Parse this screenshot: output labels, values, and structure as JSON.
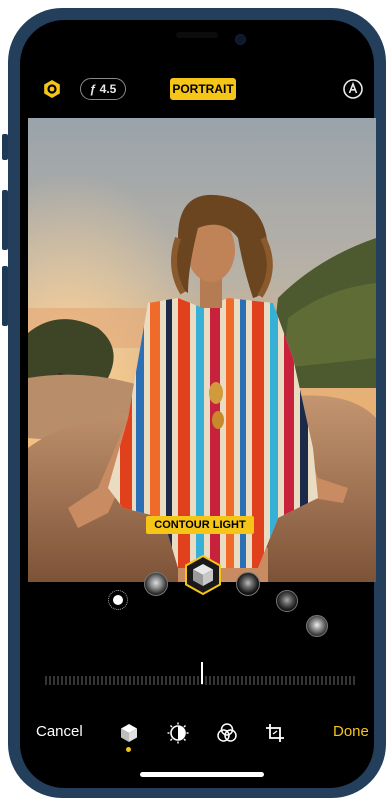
{
  "top_bar": {
    "aperture": "ƒ 4.5",
    "mode": "PORTRAIT",
    "left_icon": "live-photo-icon",
    "right_icon": "auto-enhance-icon"
  },
  "photo": {
    "effect_label": "CONTOUR LIGHT"
  },
  "lighting_options": [
    {
      "name": "natural-light"
    },
    {
      "name": "studio-light"
    },
    {
      "name": "contour-light",
      "selected": true
    },
    {
      "name": "stage-light"
    },
    {
      "name": "stage-light-mono"
    },
    {
      "name": "high-key-light-mono"
    }
  ],
  "bottom_bar": {
    "cancel": "Cancel",
    "done": "Done",
    "tools": [
      "portrait-cube-icon",
      "adjust-dial-icon",
      "filters-icon",
      "crop-icon"
    ],
    "active_tool": "portrait-cube-icon"
  },
  "colors": {
    "accent": "#f5c518",
    "frame": "#243f5c"
  }
}
